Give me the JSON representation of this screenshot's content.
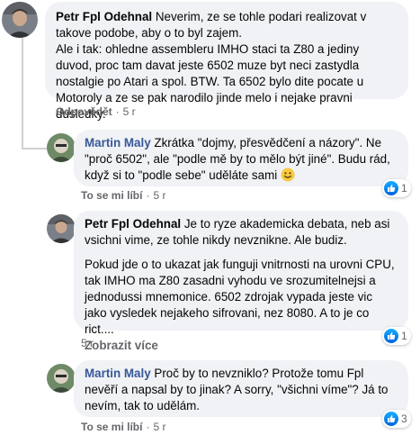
{
  "comments": [
    {
      "author": "Petr Fpl Odehnal",
      "text_first": " Neverim, ze se tohle podari realizovat v takove podobe, aby o to byl zajem.",
      "text_rest": "Ale i tak: ohledne assembleru IMHO staci ta Z80 a jediny duvod, proc tam davat jeste 6502 muze byt neci zastydla nostalgie po Atari a spol. BTW. Ta 6502 bylo dite pocate u Motoroly a ze se pak narodilo jinde melo i nejake pravni dusledky.",
      "reply_label": "Odpovědět",
      "time": "5 r"
    },
    {
      "author": "Martin Maly",
      "text": " Zkrátka \"dojmy, přesvědčení a názory\". Ne \"proč 6502\", ale \"podle mě by to mělo být jiné\". Budu rád, když si to \"podle sebe\" uděláte sami ",
      "emoji": "smile-emoji",
      "like_label": "To se mi líbí",
      "time": "5 r",
      "reactions": "1"
    },
    {
      "author": "Petr Fpl Odehnal",
      "text": " Je to ryze akademicka debata, neb asi vsichni vime, ze tohle nikdy nevznikne. Ale budiz.",
      "text2": "Pokud jde o to ukazat jak funguji vnitrnosti na urovni CPU, tak IMHO ma Z80 zasadni vyhodu ve srozumitelnejsi a jednodussi mnemonice. 6502 zdrojak vypada jeste vic jako vysledek nejakeho sifrovani, nez 8080. A to je co rict....",
      "see_more": "Zobrazit více",
      "time": "5 r",
      "reactions": "1"
    },
    {
      "author": "Martin Maly",
      "text": " Proč by to nevzniklo? Protože tomu Fpl nevěří a napsal by to jinak? A sorry, \"všichni víme\"? Já to nevím, tak to udělám.",
      "like_label": "To se mi líbí",
      "time": "5 r",
      "reactions": "3"
    }
  ],
  "colors": {
    "bubble": "#f0f2f5",
    "meta_text": "#65676b",
    "like_blue": "#1877f2"
  }
}
